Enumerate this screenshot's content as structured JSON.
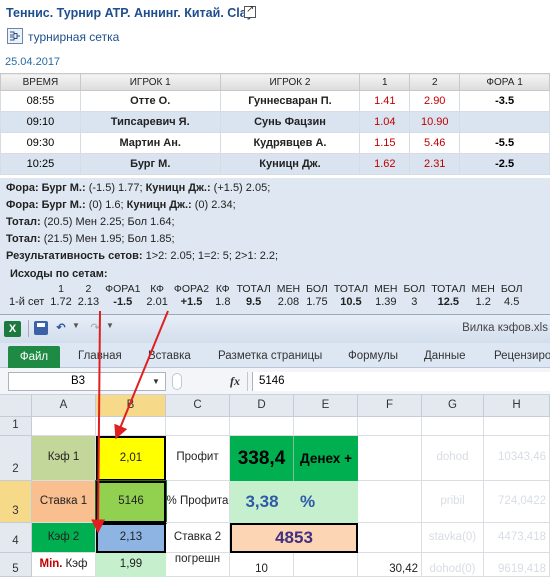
{
  "page": {
    "title": "Теннис. Турнир ATP. Аннинг. Китай. Clay.",
    "bracket_link": "турнирная сетка",
    "date": "25.04.2017"
  },
  "matches": {
    "headers": [
      "ВРЕМЯ",
      "ИГРОК 1",
      "ИГРОК 2",
      "1",
      "2",
      "ФОРА 1"
    ],
    "rows": [
      {
        "time": "08:55",
        "p1": "Отте О.",
        "p2": "Гуннесваран П.",
        "k1": "1.41",
        "k2": "2.90",
        "fora": "-3.5"
      },
      {
        "time": "09:10",
        "p1": "Типсаревич Я.",
        "p2": "Сунь Фацзин",
        "k1": "1.04",
        "k2": "10.90",
        "fora": ""
      },
      {
        "time": "09:30",
        "p1": "Мартин Ан.",
        "p2": "Кудрявцев А.",
        "k1": "1.15",
        "k2": "5.46",
        "fora": "-5.5"
      },
      {
        "time": "10:25",
        "p1": "Бург М.",
        "p2": "Куницн Дж.",
        "k1": "1.62",
        "k2": "2.31",
        "fora": "-2.5"
      }
    ]
  },
  "info": {
    "l1a": "Фора: Бург М.:",
    "l1b": " (-1.5) 1.77; ",
    "l1c": "Куницн Дж.:",
    "l1d": " (+1.5) 2.05;",
    "l2a": "Фора: Бург М.:",
    "l2b": " (0) 1.6; ",
    "l2c": "Куницн Дж.:",
    "l2d": " (0) 2.34;",
    "l3a": "Тотал:",
    "l3b": " (20.5) Мен 2.25; Бол 1.64;",
    "l4a": "Тотал:",
    "l4b": " (21.5) Мен 1.95; Бол 1.85;",
    "l5a": "Результативность сетов:",
    "l5b": " 1>2: 2.05; 1=2: 5; 2>1: 2.2;",
    "outcomes_title": "Исходы по сетам:",
    "outcome_headers": [
      "",
      "1",
      "2",
      "ФОРА1",
      "КФ",
      "ФОРА2",
      "КФ",
      "ТОТАЛ",
      "МЕН",
      "БОЛ",
      "ТОТАЛ",
      "МЕН",
      "БОЛ",
      "ТОТАЛ",
      "МЕН",
      "БОЛ"
    ],
    "outcome_values": [
      "1-й сет",
      "1.72",
      "2.13",
      "-1.5",
      "2.01",
      "+1.5",
      "1.8",
      "9.5",
      "2.08",
      "1.75",
      "10.5",
      "1.39",
      "3",
      "12.5",
      "1.2",
      "4.5"
    ]
  },
  "excel": {
    "window_title": "Вилка кэфов.xls",
    "file_tab": "Файл",
    "tabs": [
      "Главная",
      "Вставка",
      "Разметка страницы",
      "Формулы",
      "Данные",
      "Рецензиро"
    ],
    "name_box": "B3",
    "formula": "5146",
    "columns": [
      "A",
      "B",
      "C",
      "D",
      "E",
      "F",
      "G",
      "H"
    ],
    "rows": [
      "1",
      "2",
      "3",
      "4",
      "5"
    ],
    "cells": {
      "a2": "Кэф 1",
      "b2": "2,01",
      "c2": "Профит",
      "d2": "338,4",
      "e2": "Денех +",
      "g2": "dohod",
      "h2": "10343,46",
      "a3": "Ставка 1",
      "b3": "5146",
      "c3": "% Профита",
      "d3": "3,38",
      "e3": "%",
      "g3": "pribil",
      "h3": "724,0422",
      "a4": "Кэф 2",
      "b4": "2,13",
      "c4": "Ставка 2",
      "d4": "4853",
      "g4": "stavka(0)",
      "h4": "4473,418",
      "a5_red": "Min.",
      "a5": "Кэф",
      "b5": "1,99",
      "c5": "погрешн",
      "d5": "10",
      "f5": "30,42",
      "g5": "dohod(0)",
      "h5": "9619,418"
    },
    "colors": {
      "cell_b2": "#ffff00",
      "cell_b3": "#92d050",
      "cell_b4": "#8db4e2",
      "cell_d2": "#00b050",
      "cell_d3": "#c6efce",
      "cell_d4": "#fcd5b4",
      "cell_a2": "#c4d79b",
      "cell_a3": "#fabf8f",
      "cell_a4": "#00b050",
      "arrow": "#e02020"
    }
  }
}
